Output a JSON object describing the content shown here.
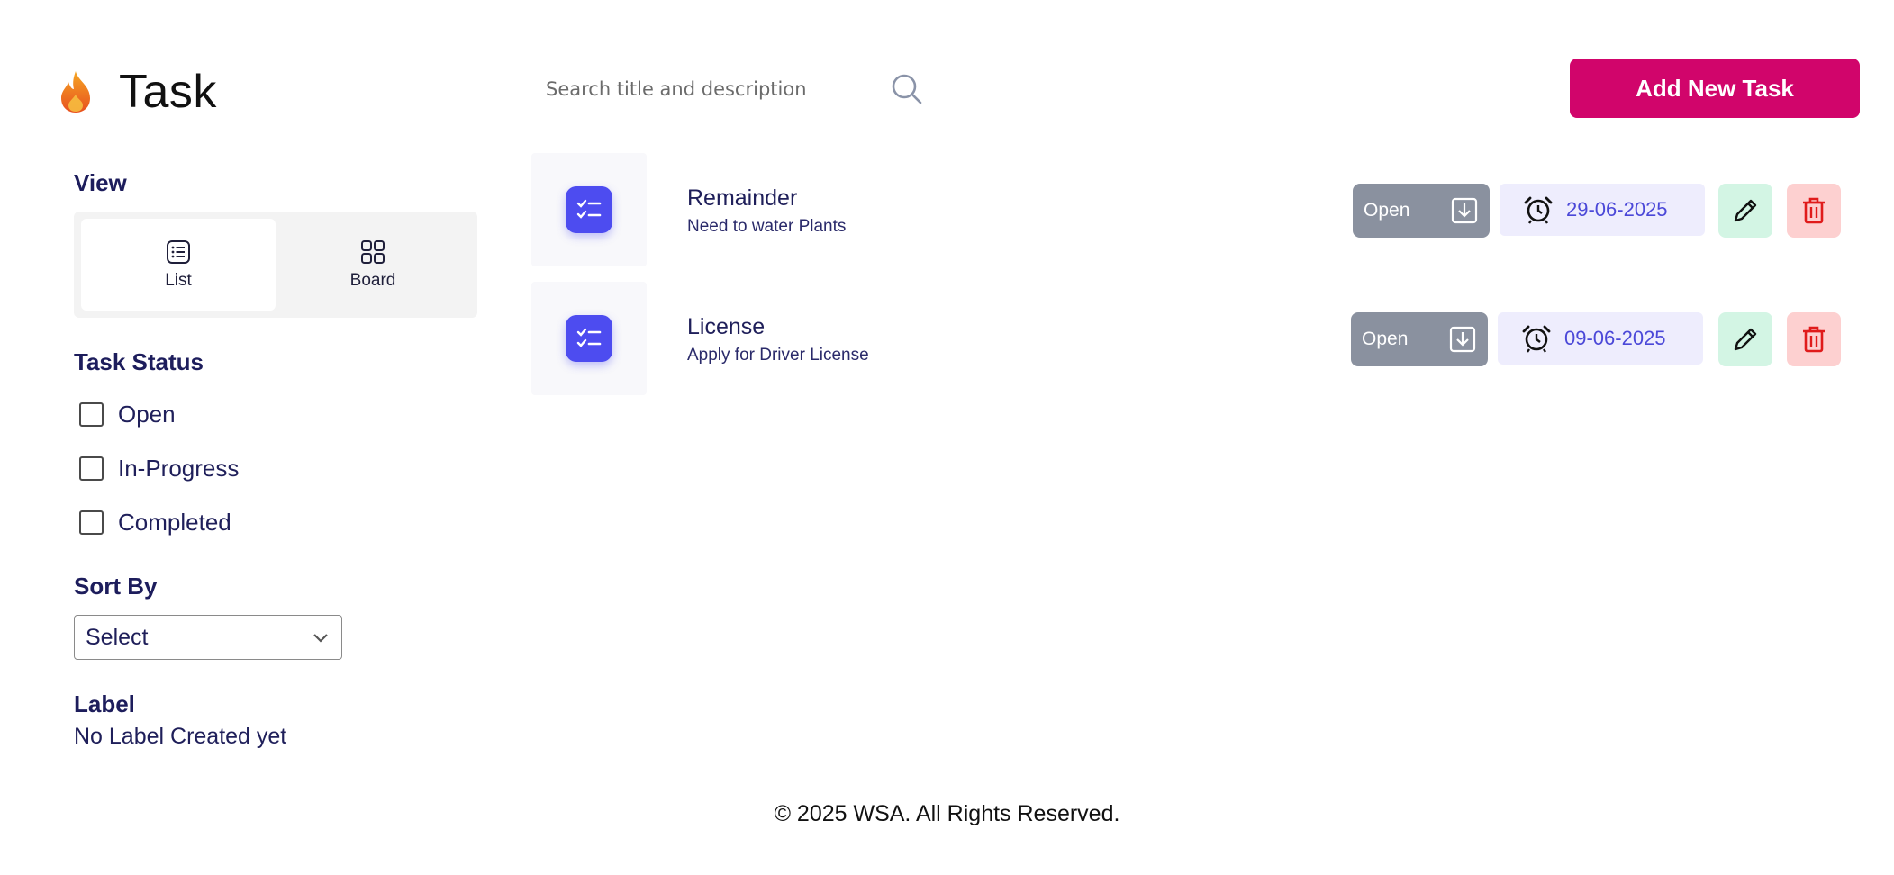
{
  "header": {
    "app_title": "Task",
    "search_placeholder": "Search title and description",
    "add_button_label": "Add New Task"
  },
  "sidebar": {
    "view_title": "View",
    "view_options": [
      {
        "label": "List",
        "icon": "list-icon",
        "active": true
      },
      {
        "label": "Board",
        "icon": "grid-icon",
        "active": false
      }
    ],
    "status_title": "Task Status",
    "status_options": [
      {
        "label": "Open",
        "checked": false
      },
      {
        "label": "In-Progress",
        "checked": false
      },
      {
        "label": "Completed",
        "checked": false
      }
    ],
    "sort_title": "Sort By",
    "sort_selected": "Select",
    "label_title": "Label",
    "label_empty": "No Label Created yet"
  },
  "tasks": [
    {
      "title": "Remainder",
      "description": "Need to water Plants",
      "status": "Open",
      "due_date": "29-06-2025"
    },
    {
      "title": "License",
      "description": "Apply for Driver License",
      "status": "Open",
      "due_date": "09-06-2025"
    }
  ],
  "footer": {
    "copyright": "© 2025 WSA. All Rights Reserved."
  },
  "colors": {
    "accent": "#d1056b",
    "task_icon": "#4d4cf0",
    "status_button": "#8a919f",
    "date_badge_bg": "#eeedfd",
    "edit_bg": "#d3f5e4",
    "delete_bg": "#fdd0d0",
    "delete_icon": "#e01b1b"
  }
}
